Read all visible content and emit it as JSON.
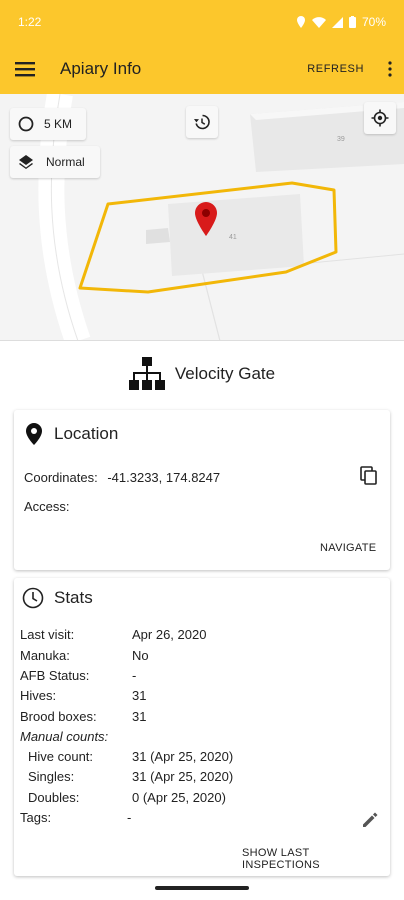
{
  "status_bar": {
    "time": "1:22",
    "battery": "70%"
  },
  "app_bar": {
    "title": "Apiary Info",
    "refresh_label": "REFRESH"
  },
  "map": {
    "radius_label": "5 KM",
    "map_type_label": "Normal",
    "building_numbers": [
      "39",
      "41"
    ],
    "polygon_color": "#f2b708",
    "pin_color": "#d81b1b"
  },
  "site": {
    "name": "Velocity Gate"
  },
  "location_card": {
    "title": "Location",
    "coordinates_label": "Coordinates:",
    "coordinates_value": "-41.3233, 174.8247",
    "access_label": "Access:",
    "access_value": "",
    "navigate_label": "NAVIGATE"
  },
  "stats_card": {
    "title": "Stats",
    "rows": [
      {
        "label": "Last visit:",
        "value": "Apr 26, 2020"
      },
      {
        "label": "Manuka:",
        "value": "No"
      },
      {
        "label": "AFB Status:",
        "value": "-"
      },
      {
        "label": "Hives:",
        "value": "31"
      },
      {
        "label": "Brood boxes:",
        "value": "31"
      }
    ],
    "manual_counts_label": "Manual counts:",
    "manual_rows": [
      {
        "label": "Hive count:",
        "value": "31 (Apr 25, 2020)"
      },
      {
        "label": "Singles:",
        "value": "31 (Apr 25, 2020)"
      },
      {
        "label": "Doubles:",
        "value": "0 (Apr 25, 2020)"
      }
    ],
    "tags_label": "Tags:",
    "tags_value": "-",
    "show_inspections_label": "SHOW LAST INSPECTIONS"
  },
  "colors": {
    "accent": "#fcc72c"
  }
}
